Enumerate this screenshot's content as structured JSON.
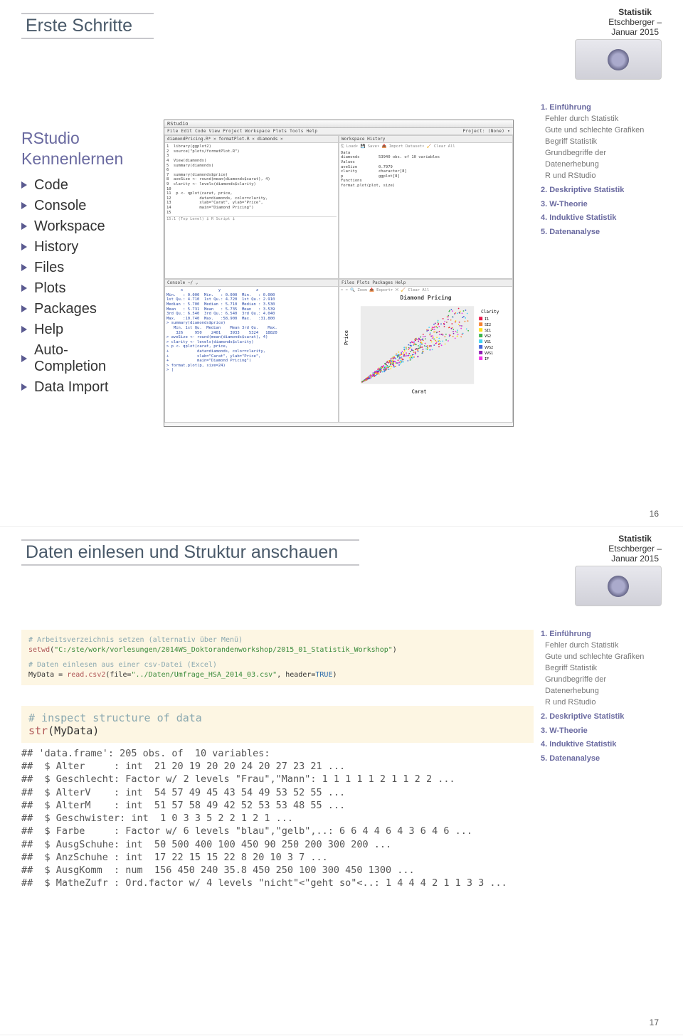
{
  "header": {
    "brand": "Statistik",
    "sub": "Etschberger –\nJanuar 2015"
  },
  "slide1": {
    "title": "Erste Schritte",
    "intro_h1": "RStudio",
    "intro_h2": "Kennenlernen",
    "bullets": [
      "Code",
      "Console",
      "Workspace",
      "History",
      "Files",
      "Plots",
      "Packages",
      "Help",
      "Auto-\nCompletion",
      "Data Import"
    ],
    "pagenum": "16"
  },
  "shot": {
    "title": "RStudio",
    "menu": "File  Edit  Code  View  Project  Workspace  Plots  Tools  Help",
    "project": "Project: (None) ▾",
    "src_tab": "diamondPricing.R* ×   formatPlot.R ×       diamonds ×",
    "src_lines": [
      "1  library(ggplot2)",
      "2  source(\"plots/formatPlot.R\")",
      "3",
      "4  View(diamonds)",
      "5  summary(diamonds)",
      "6",
      "7  summary(diamonds$price)",
      "8  aveSize <- round(mean(diamonds$carat), 4)",
      "9  clarity <- levels(diamonds$clarity)",
      "10",
      "11  p <- qplot(carat, price,",
      "12            data=diamonds, color=clarity,",
      "13            xlab=\"Carat\", ylab=\"Price\",",
      "14            main=\"Diamond Pricing\")",
      "15"
    ],
    "src_foot": "15:1   (Top Level) ‡                                   R Script ‡",
    "ws_tab": "Workspace   History",
    "ws_tools": "⎘ Load▾  💾 Save▾   📥 Import Dataset▾   🧹 Clear All",
    "ws_body": "Data\ndiamonds        53940 obs. of 10 variables\nValues\naveSize         0.7979\nclarity         character[8]\np               ggplot[8]\nFunctions\nformat.plot(plot, size)",
    "plot_tab": "Files   Plots   Packages   Help",
    "plot_tools": "⬅ ➡   🔍 Zoom   📤 Export▾   ⨉   🧹 Clear All",
    "plot_title": "Diamond Pricing",
    "console_tab": "Console  ~/  ⌄",
    "console_body": "      x               y               z\nMin.   : 0.000  Min.   : 0.000  Min.   : 0.000\n1st Qu.: 4.710  1st Qu.: 4.720  1st Qu.: 2.910\nMedian : 5.700  Median : 5.710  Median : 3.530\nMean   : 5.731  Mean   : 5.735  Mean   : 3.539\n3rd Qu.: 6.540  3rd Qu.: 6.540  3rd Qu.: 4.040\nMax.   :10.740  Max.   :58.900  Max.   :31.800\n> summary(diamonds$price)\n   Min. 1st Qu.  Median    Mean 3rd Qu.    Max.\n    326     950    2401    3933    5324   18820\n> aveSize <- round(mean(diamonds$carat), 4)\n> clarity <- levels(diamonds$clarity)\n> p <- qplot(carat, price,\n+            data=diamonds, color=clarity,\n+            xlab=\"Carat\", ylab=\"Price\",\n+            main=\"Diamond Pricing\")\n> format.plot(p, size=24)\n> |"
  },
  "nav": {
    "s1": "1. Einführung",
    "s1a": "Fehler durch Statistik",
    "s1b": "Gute und schlechte Grafiken",
    "s1c": "Begriff Statistik",
    "s1d": "Grundbegriffe der Datenerhebung",
    "s1e": "R und RStudio",
    "s2": "2. Deskriptive Statistik",
    "s3": "3. W-Theorie",
    "s4": "4. Induktive Statistik",
    "s5": "5. Datenanalyse"
  },
  "slide2": {
    "title": "Daten einlesen und Struktur anschauen",
    "c1_cmt1": "# Arbeitsverzeichnis setzen (alternativ über Menü)",
    "c1_l1a": "setwd",
    "c1_l1b": "(",
    "c1_l1c": "\"C:/ste/work/vorlesungen/2014WS_Doktorandenworkshop/2015_01_Statistik_Workshop\"",
    "c1_l1d": ")",
    "c1_cmt2": "# Daten einlesen aus einer csv-Datei (Excel)",
    "c1_l2a": "MyData = ",
    "c1_l2b": "read.csv2",
    "c1_l2c": "(file=",
    "c1_l2d": "\"../Daten/Umfrage_HSA_2014_03.csv\"",
    "c1_l2e": ", header=",
    "c1_l2f": "TRUE",
    "c1_l2g": ")",
    "c2_cmt": "# inspect structure of data",
    "c2_fn": "str",
    "c2_arg": "(MyData)",
    "out": "## 'data.frame': 205 obs. of  10 variables:\n##  $ Alter     : int  21 20 19 20 20 24 20 27 23 21 ...\n##  $ Geschlecht: Factor w/ 2 levels \"Frau\",\"Mann\": 1 1 1 1 1 2 1 1 2 2 ...\n##  $ AlterV    : int  54 57 49 45 43 54 49 53 52 55 ...\n##  $ AlterM    : int  51 57 58 49 42 52 53 53 48 55 ...\n##  $ Geschwister: int  1 0 3 3 5 2 2 1 2 1 ...\n##  $ Farbe     : Factor w/ 6 levels \"blau\",\"gelb\",..: 6 6 4 4 6 4 3 6 4 6 ...\n##  $ AusgSchuhe: int  50 500 400 100 450 90 250 200 300 200 ...\n##  $ AnzSchuhe : int  17 22 15 15 22 8 20 10 3 7 ...\n##  $ AusgKomm  : num  156 450 240 35.8 450 250 100 300 450 1300 ...\n##  $ MatheZufr : Ord.factor w/ 4 levels \"nicht\"<\"geht so\"<..: 1 4 4 4 2 1 1 3 3 ...",
    "pagenum": "17"
  }
}
